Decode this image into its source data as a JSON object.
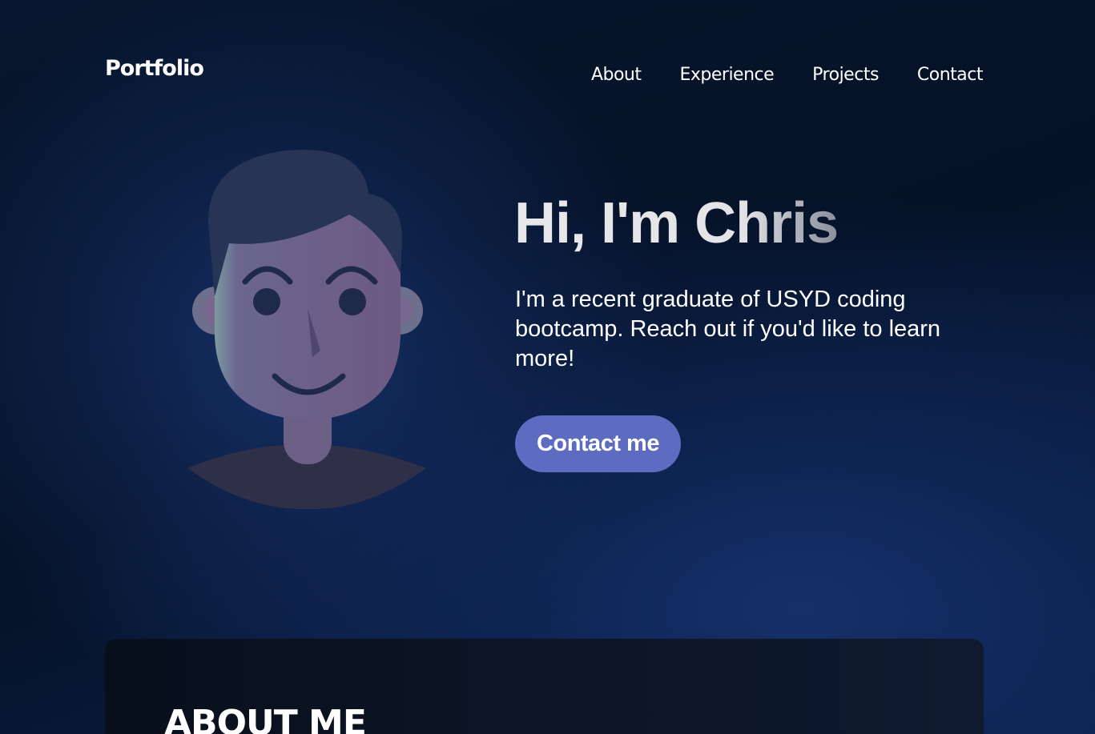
{
  "brand": {
    "logo_text": "Portfolio"
  },
  "nav": {
    "items": [
      {
        "label": "About"
      },
      {
        "label": "Experience"
      },
      {
        "label": "Projects"
      },
      {
        "label": "Contact"
      }
    ]
  },
  "hero": {
    "title": "Hi, I'm Chris",
    "description": "I'm a recent graduate of USYD coding bootcamp. Reach out if you'd like to learn more!",
    "cta_label": "Contact me",
    "avatar_icon": "person-avatar-illustration"
  },
  "about": {
    "heading": "ABOUT ME"
  },
  "colors": {
    "background_dark": "#051126",
    "background_glow": "#163066",
    "button": "#5d6cc0",
    "card": "#0d1628",
    "text": "#ffffff"
  }
}
